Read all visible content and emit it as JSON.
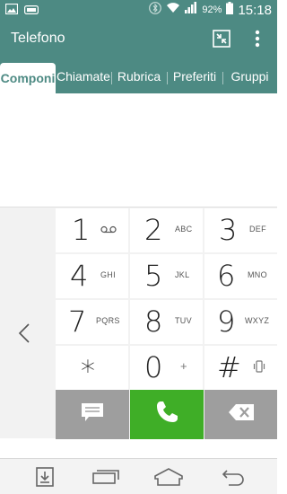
{
  "status_bar": {
    "battery_text": "92%",
    "time": "15:18",
    "icons": [
      "image-notification-icon",
      "voicemail-notification-icon",
      "bluetooth-icon",
      "wifi-icon",
      "signal-icon",
      "battery-icon"
    ]
  },
  "action_bar": {
    "title": "Telefono",
    "icons": [
      "speed-dial-icon",
      "overflow-menu-icon"
    ]
  },
  "tabs": [
    {
      "label": "Componi"
    },
    {
      "label": "Chiamate"
    },
    {
      "label": "Rubrica"
    },
    {
      "label": "Preferiti"
    },
    {
      "label": "Gruppi"
    }
  ],
  "active_tab": "Componi",
  "keypad": {
    "keys": [
      {
        "digit": "1",
        "sub": "",
        "icon": "voicemail-icon"
      },
      {
        "digit": "2",
        "sub": "ABC"
      },
      {
        "digit": "3",
        "sub": "DEF"
      },
      {
        "digit": "4",
        "sub": "GHI"
      },
      {
        "digit": "5",
        "sub": "JKL"
      },
      {
        "digit": "6",
        "sub": "MNO"
      },
      {
        "digit": "7",
        "sub": "PQRS"
      },
      {
        "digit": "8",
        "sub": "TUV"
      },
      {
        "digit": "9",
        "sub": "WXYZ"
      },
      {
        "digit": "*",
        "sub": ""
      },
      {
        "digit": "0",
        "sub": "+"
      },
      {
        "digit": "#",
        "sub": "",
        "icon": "vibrate-icon"
      }
    ],
    "actions": [
      "message-icon",
      "call-icon",
      "backspace-icon"
    ]
  },
  "nav_bar": {
    "icons": [
      "notification-drawer-icon",
      "recent-apps-icon",
      "home-icon",
      "back-icon"
    ]
  },
  "colors": {
    "primary": "#4d8a83",
    "call_green": "#3fae27",
    "action_gray": "#9e9e9e",
    "key_background": "#ffffff"
  }
}
